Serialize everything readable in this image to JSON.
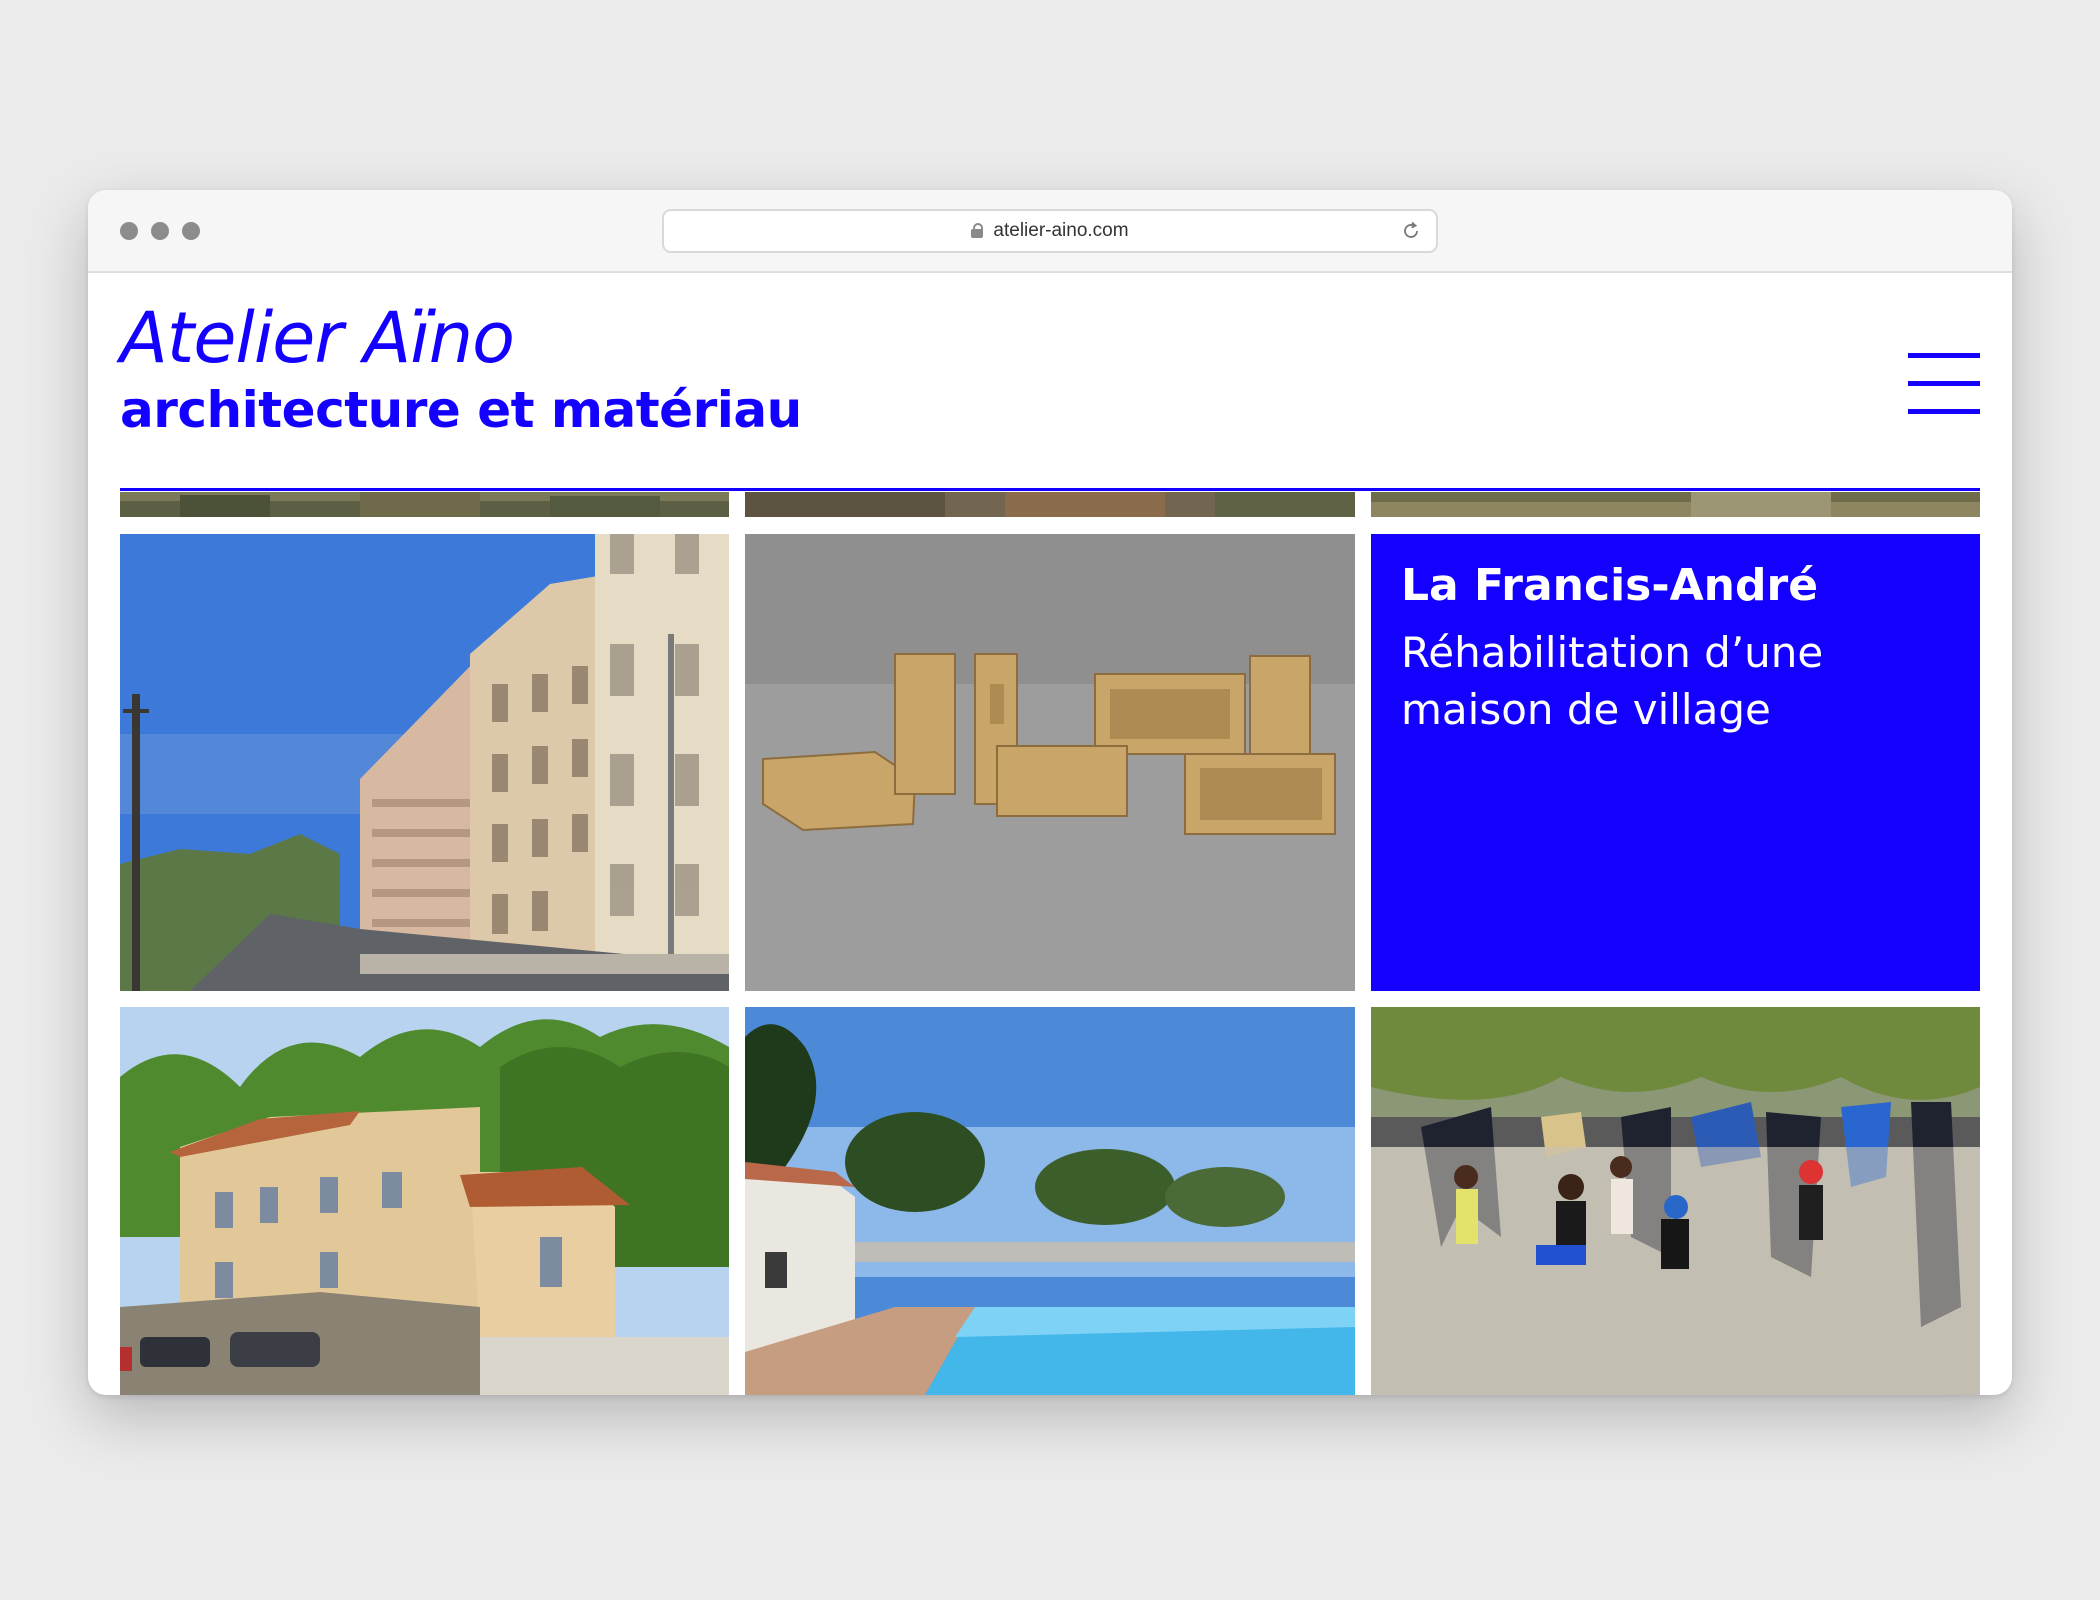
{
  "browser": {
    "url": "atelier-aino.com",
    "window_controls": [
      "close",
      "minimize",
      "maximize"
    ]
  },
  "site": {
    "title": "Atelier Aïno",
    "subtitle": "architecture et matériau",
    "menu_icon": "hamburger-menu-icon",
    "accent_color": "#1400ff"
  },
  "grid": {
    "featured": {
      "title": "La Francis-André",
      "description": "Réhabilitation d’une\nmaison de village"
    }
  },
  "colors": {
    "accent": "#1400ff",
    "page_background": "#ebebeb",
    "window_background": "#ffffff"
  }
}
